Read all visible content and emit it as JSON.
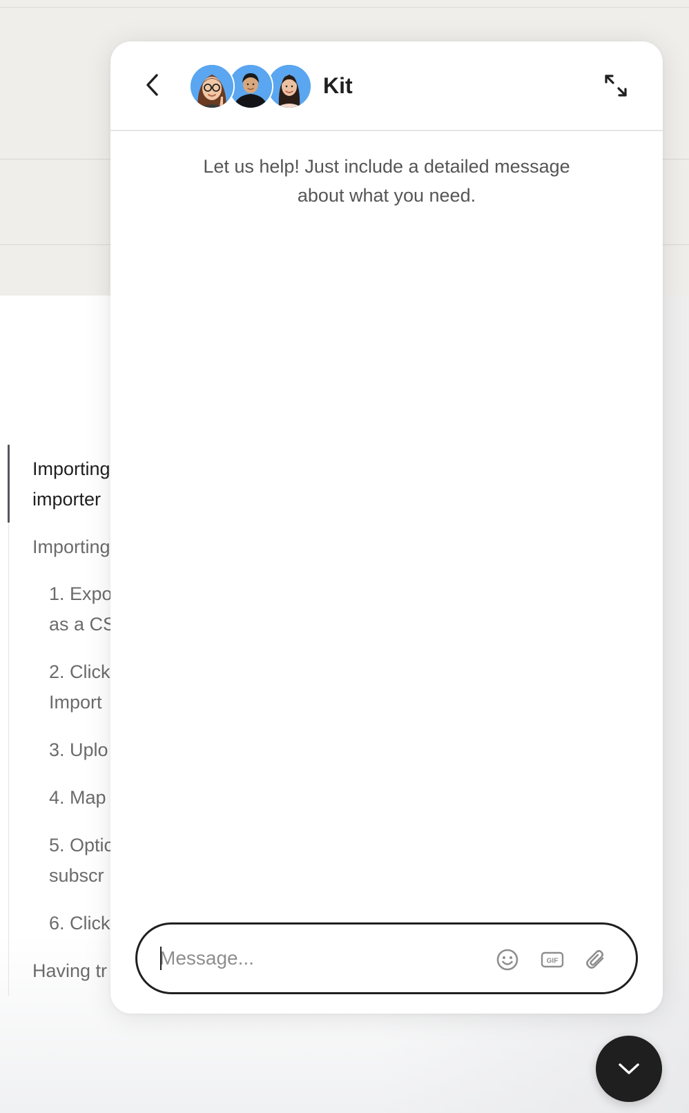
{
  "background_page": {
    "toc": [
      {
        "text": "Importing",
        "active": true
      },
      {
        "text": "importer",
        "active": true
      },
      {
        "text": "Importing",
        "active": false
      },
      {
        "text": "1. Expo",
        "active": false
      },
      {
        "text": "as a CS",
        "active": false
      },
      {
        "text": "2. Click",
        "active": false
      },
      {
        "text": "Import",
        "active": false
      },
      {
        "text": "3. Uplo",
        "active": false
      },
      {
        "text": "4. Map",
        "active": false
      },
      {
        "text": "5. Optic",
        "active": false
      },
      {
        "text": "subscr",
        "active": false
      },
      {
        "text": "6. Click",
        "active": false
      },
      {
        "text": "Having tr",
        "active": false
      }
    ]
  },
  "chat": {
    "header": {
      "back_icon": "chevron-left-icon",
      "team_name": "Kit",
      "expand_icon": "expand-arrows-icon",
      "avatar_bg": "#5aa6f0"
    },
    "intro_text": "Let us help! Just include a detailed message about what you need.",
    "composer": {
      "placeholder": "Message...",
      "value": "",
      "tools": [
        "emoji-icon",
        "gif-icon",
        "attachment-icon"
      ],
      "gif_label": "GIF"
    }
  },
  "launcher": {
    "icon": "chevron-down-icon",
    "color": "#1f1f1f"
  }
}
